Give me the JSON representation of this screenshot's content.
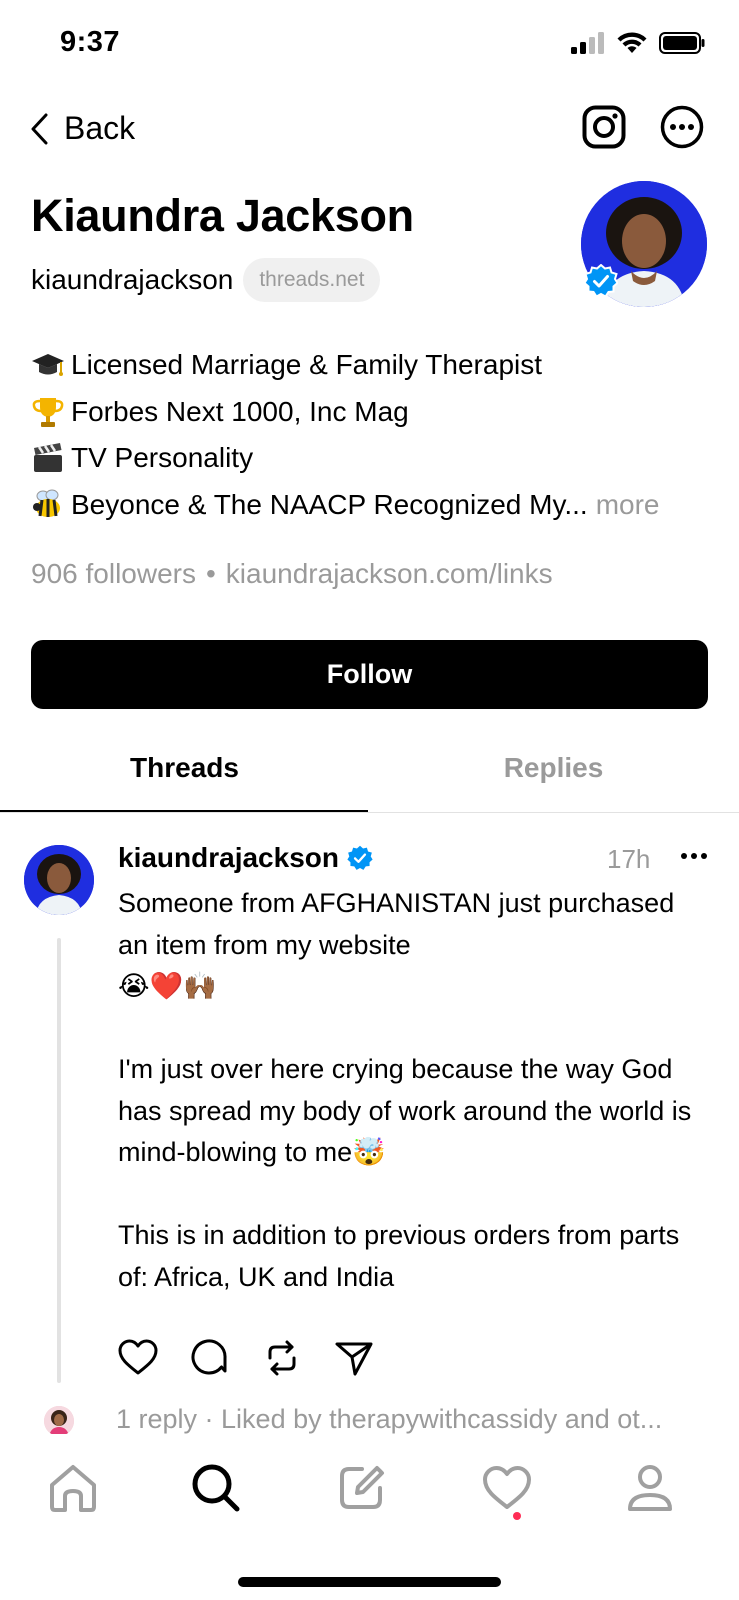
{
  "status_bar": {
    "time": "9:37"
  },
  "nav": {
    "back_label": "Back"
  },
  "profile": {
    "name": "Kiaundra Jackson",
    "handle": "kiaundrajackson",
    "domain": "threads.net",
    "bio": [
      {
        "emoji": "graduation-cap",
        "text": "Licensed Marriage & Family Therapist"
      },
      {
        "emoji": "trophy",
        "text": "Forbes Next 1000, Inc Mag"
      },
      {
        "emoji": "clapper-board",
        "text": " TV Personality"
      },
      {
        "emoji": "honeybee",
        "text": "Beyonce & The NAACP Recognized My..."
      }
    ],
    "more_label": "more",
    "followers": "906 followers",
    "separator": "•",
    "link": "kiaundrajackson.com/links",
    "follow_label": "Follow"
  },
  "tabs": [
    {
      "label": "Threads",
      "active": true
    },
    {
      "label": "Replies",
      "active": false
    }
  ],
  "post": {
    "username": "kiaundrajackson",
    "time": "17h",
    "text": "Someone from AFGHANISTAN just purchased an item from my website\n😭❤️🙌🏾\n\nI'm just over here crying because the way God has spread my body of work around the world is mind-blowing to me🤯\n\nThis is in addition to previous orders from parts of: Africa, UK and India",
    "footer": "1 reply ·  Liked by therapywithcassidy and ot..."
  },
  "colors": {
    "accent_blue": "#0095f6",
    "avatar_bg": "#1f2ee0",
    "muted": "#9a9a9a",
    "notification_dot": "#ff2d55"
  },
  "bottom_nav": [
    "home-icon",
    "search-icon",
    "compose-icon",
    "heart-icon",
    "profile-icon"
  ]
}
